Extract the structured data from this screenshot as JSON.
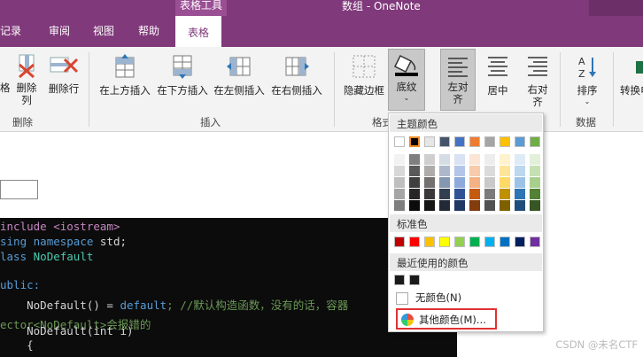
{
  "title_bar": {
    "context_tab": "表格工具",
    "document_title": "数组 - OneNote"
  },
  "tabs": [
    {
      "label": "记录"
    },
    {
      "label": "审阅"
    },
    {
      "label": "视图"
    },
    {
      "label": "帮助"
    },
    {
      "label": "表格"
    }
  ],
  "ribbon": {
    "delete_group": {
      "label": "删除",
      "buttons": [
        {
          "label": "格"
        },
        {
          "label": "删除列"
        },
        {
          "label": "删除行"
        }
      ]
    },
    "insert_group": {
      "label": "插入",
      "buttons": [
        {
          "label": "在上方插入"
        },
        {
          "label": "在下方插入"
        },
        {
          "label": "在左侧插入"
        },
        {
          "label": "在右侧插入"
        }
      ]
    },
    "format_group": {
      "label": "格式",
      "buttons": [
        {
          "label": "隐藏边框"
        },
        {
          "label": "底纹"
        }
      ]
    },
    "align_group": {
      "buttons": [
        {
          "label": "左对齐"
        },
        {
          "label": "居中"
        },
        {
          "label": "右对齐"
        }
      ]
    },
    "data_group": {
      "label": "数据",
      "buttons": [
        {
          "label": "排序"
        },
        {
          "label": "转换电"
        }
      ]
    }
  },
  "shading_menu": {
    "theme_colors_header": "主题颜色",
    "standard_colors_header": "标准色",
    "recent_colors_header": "最近使用的颜色",
    "no_color": "无颜色(N)",
    "more_colors": "其他颜色(M)...",
    "theme_top_row": [
      "#ffffff",
      "#000000",
      "#e7e6e6",
      "#44546a",
      "#4472c4",
      "#ed7d31",
      "#a5a5a5",
      "#ffc000",
      "#5b9bd5",
      "#70ad47"
    ],
    "theme_shades": [
      [
        "#f2f2f2",
        "#7f7f7f",
        "#d0cece",
        "#d6dce4",
        "#d9e2f3",
        "#fbe5d5",
        "#ededed",
        "#fff2cc",
        "#ddebf7",
        "#e2efd9"
      ],
      [
        "#d8d8d8",
        "#595959",
        "#aeabab",
        "#adb9ca",
        "#b4c6e7",
        "#f7cbac",
        "#dbdbdb",
        "#fee599",
        "#bdd7ee",
        "#c5e0b3"
      ],
      [
        "#bfbfbf",
        "#3f3f3f",
        "#757070",
        "#8496b0",
        "#8eaadb",
        "#f4b183",
        "#c9c9c9",
        "#ffd965",
        "#9cc3e5",
        "#a8d08d"
      ],
      [
        "#a5a5a5",
        "#262626",
        "#3a3838",
        "#323f4f",
        "#2f5496",
        "#c55a11",
        "#7b7b7b",
        "#bf9000",
        "#2e75b5",
        "#538135"
      ],
      [
        "#7f7f7f",
        "#0c0c0c",
        "#171616",
        "#222a35",
        "#1f3864",
        "#833c0b",
        "#525252",
        "#7f6000",
        "#1e4e79",
        "#375623"
      ]
    ],
    "standard_colors": [
      "#c00000",
      "#ff0000",
      "#ffc000",
      "#ffff00",
      "#92d050",
      "#00b050",
      "#00b0f0",
      "#0070c0",
      "#002060",
      "#7030a0"
    ],
    "recent_colors": [
      "#1a1a1a",
      "#1a1a1a"
    ]
  },
  "code_lines": {
    "l1": "include <iostream>",
    "l2a": "sing ",
    "l2b": "namespace",
    "l2c": " std;",
    "l3a": "lass ",
    "l3b": "NoDefault",
    "l4": "ublic:",
    "l5a": "    NoDefault() = ",
    "l5b": "default",
    "l5c": "; //默认构造函数，没有的话，容器",
    "l6": "ector<NoDefault>会报错的",
    "l7": "    NoDefault(int i)",
    "l8": "    {"
  },
  "watermark": "CSDN @未名CTF"
}
